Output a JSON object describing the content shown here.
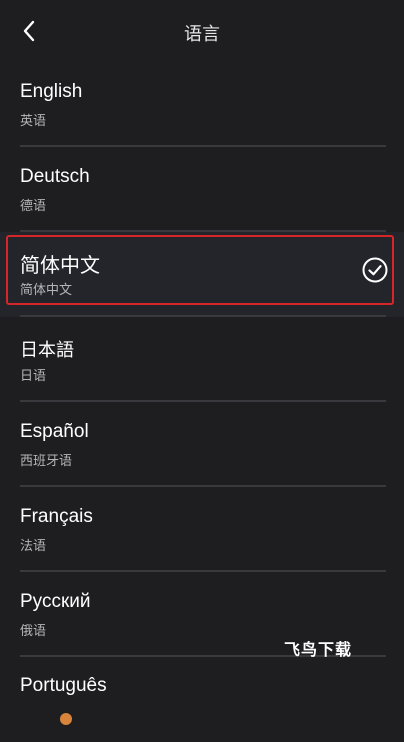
{
  "header": {
    "title": "语言",
    "back_icon": "chevron-left-icon"
  },
  "languages": [
    {
      "name": "English",
      "sub": "英语",
      "selected": false
    },
    {
      "name": "Deutsch",
      "sub": "德语",
      "selected": false
    },
    {
      "name": "简体中文",
      "sub": "简体中文",
      "selected": true
    },
    {
      "name": "日本語",
      "sub": "日语",
      "selected": false
    },
    {
      "name": "Español",
      "sub": "西班牙语",
      "selected": false
    },
    {
      "name": "Français",
      "sub": "法语",
      "selected": false
    },
    {
      "name": "Русский",
      "sub": "俄语",
      "selected": false
    },
    {
      "name": "Português",
      "sub": "",
      "selected": false
    }
  ],
  "selected_icon": "check-circle-icon",
  "watermark": "飞鸟下载",
  "colors": {
    "background": "#1e1e21",
    "divider": "#3a3a3e",
    "highlight_border": "#d6262a"
  }
}
